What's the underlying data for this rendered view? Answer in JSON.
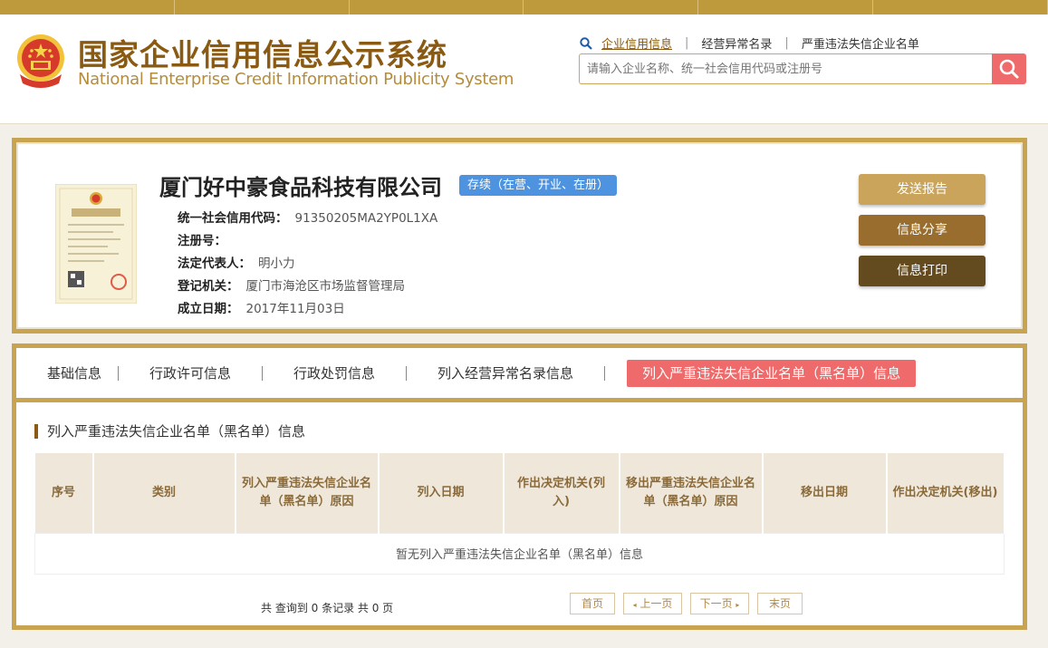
{
  "header": {
    "title_cn": "国家企业信用信息公示系统",
    "title_en": "National Enterprise Credit Information Publicity System",
    "links": [
      "企业信用信息",
      "经营异常名录",
      "严重违法失信企业名单"
    ],
    "search_placeholder": "请输入企业名称、统一社会信用代码或注册号"
  },
  "company": {
    "name": "厦门好中豪食品科技有限公司",
    "status": "存续（在营、开业、在册）",
    "fields": [
      {
        "label": "统一社会信用代码：",
        "value": "91350205MA2YP0L1XA"
      },
      {
        "label": "注册号：",
        "value": ""
      },
      {
        "label": "法定代表人：",
        "value": "明小力"
      },
      {
        "label": "登记机关：",
        "value": "厦门市海沧区市场监督管理局"
      },
      {
        "label": "成立日期：",
        "value": "2017年11月03日"
      }
    ],
    "license_label": "营业执照"
  },
  "actions": {
    "send": "发送报告",
    "share": "信息分享",
    "print": "信息打印"
  },
  "tabs": [
    "基础信息",
    "行政许可信息",
    "行政处罚信息",
    "列入经营异常名录信息",
    "列入严重违法失信企业名单（黑名单）信息"
  ],
  "section": {
    "title": "列入严重违法失信企业名单（黑名单）信息",
    "columns": [
      "序号",
      "类别",
      "列入严重违法失信企业名单（黑名单）原因",
      "列入日期",
      "作出决定机关(列入)",
      "移出严重违法失信企业名单（黑名单）原因",
      "移出日期",
      "作出决定机关(移出)"
    ],
    "empty_text": "暂无列入严重违法失信企业名单（黑名单）信息"
  },
  "pager": {
    "info": "共 查询到 0 条记录 共 0 页",
    "first": "首页",
    "prev": "上一页",
    "next": "下一页",
    "last": "末页"
  },
  "colors": {
    "gold": "#c9a450",
    "brown": "#8a5a12",
    "accent_red": "#ef6a6a",
    "status_blue": "#4d93e0"
  }
}
